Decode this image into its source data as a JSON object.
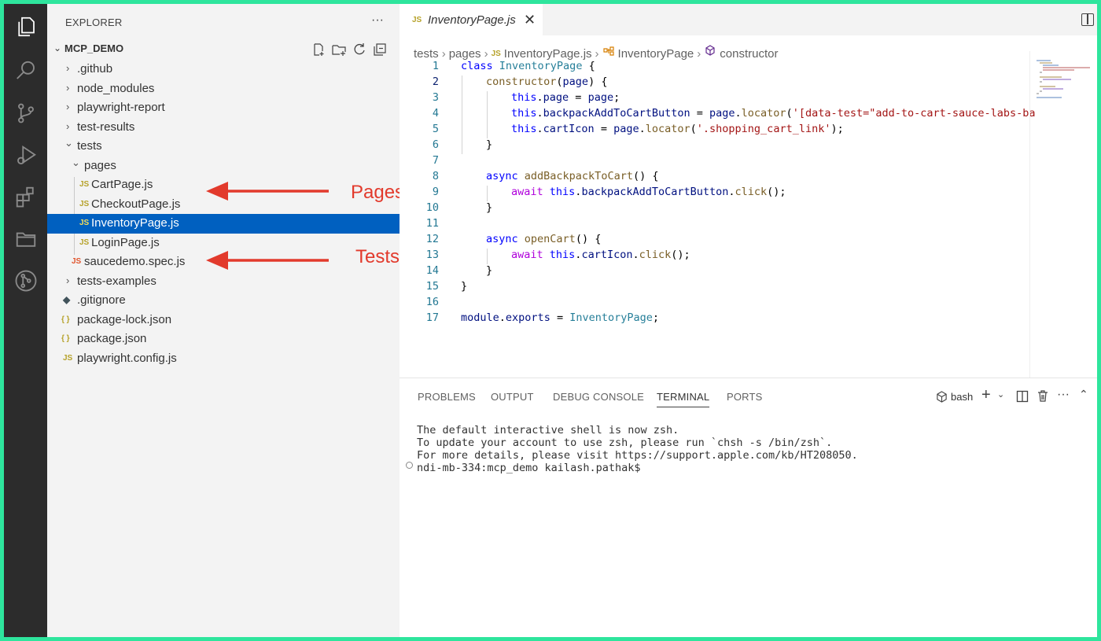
{
  "sidebar": {
    "title": "EXPLORER",
    "more": "···",
    "project": "MCP_DEMO",
    "tree": [
      {
        "label": ".github",
        "chevron": "›"
      },
      {
        "label": "node_modules",
        "chevron": "›"
      },
      {
        "label": "playwright-report",
        "chevron": "›"
      },
      {
        "label": "test-results",
        "chevron": "›"
      },
      {
        "label": "tests",
        "chevron": "⌄"
      },
      {
        "label": "pages",
        "chevron": "⌄"
      },
      {
        "label": "CartPage.js",
        "icon": "JS"
      },
      {
        "label": "CheckoutPage.js",
        "icon": "JS"
      },
      {
        "label": "InventoryPage.js",
        "icon": "JS"
      },
      {
        "label": "LoginPage.js",
        "icon": "JS"
      },
      {
        "label": "saucedemo.spec.js",
        "icon": "JS"
      },
      {
        "label": "tests-examples",
        "chevron": "›"
      },
      {
        "label": ".gitignore",
        "icon": "◆"
      },
      {
        "label": "package-lock.json",
        "icon": "{ }"
      },
      {
        "label": "package.json",
        "icon": "{ }"
      },
      {
        "label": "playwright.config.js",
        "icon": "JS"
      }
    ]
  },
  "annotations": {
    "pages": "Pages",
    "tests": "Tests"
  },
  "editor": {
    "tab_icon": "JS",
    "tab_title": "InventoryPage.js",
    "tab_close": "✕",
    "breadcrumb": {
      "p1": "tests",
      "p2": "pages",
      "icon": "JS",
      "p3": "InventoryPage.js",
      "p4": "InventoryPage",
      "p5": "constructor"
    },
    "line_numbers": [
      "1",
      "2",
      "3",
      "4",
      "5",
      "6",
      "7",
      "8",
      "9",
      "10",
      "11",
      "12",
      "13",
      "14",
      "15",
      "16",
      "17"
    ],
    "code": {
      "l1_kw": "class",
      "l1_cls": "InventoryPage",
      "l1_rest": " {",
      "l2_fn": "constructor",
      "l2_a": "(",
      "l2_p": "page",
      "l2_b": ") {",
      "l3_kw": "this",
      "l3_a": ".",
      "l3_p": "page",
      "l3_b": " = ",
      "l3_v": "page",
      "l3_c": ";",
      "l4_kw": "this",
      "l4_a": ".",
      "l4_p": "backpackAddToCartButton",
      "l4_b": " = ",
      "l4_v": "page",
      "l4_c": ".",
      "l4_fn": "locator",
      "l4_d": "(",
      "l4_s": "'[data-test=\"add-to-cart-sauce-labs-ba",
      "l5_kw": "this",
      "l5_a": ".",
      "l5_p": "cartIcon",
      "l5_b": " = ",
      "l5_v": "page",
      "l5_c": ".",
      "l5_fn": "locator",
      "l5_d": "(",
      "l5_s": "'.shopping_cart_link'",
      "l5_e": ");",
      "l6": "}",
      "l8_kw": "async",
      "l8_fn": "addBackpackToCart",
      "l8_rest": "() {",
      "l9_kw": "await",
      "l9_this": "this",
      "l9_a": ".",
      "l9_p": "backpackAddToCartButton",
      "l9_b": ".",
      "l9_fn": "click",
      "l9_c": "();",
      "l10": "}",
      "l12_kw": "async",
      "l12_fn": "openCart",
      "l12_rest": "() {",
      "l13_kw": "await",
      "l13_this": "this",
      "l13_a": ".",
      "l13_p": "cartIcon",
      "l13_b": ".",
      "l13_fn": "click",
      "l13_c": "();",
      "l14": "}",
      "l15": "}",
      "l17_a": "module",
      "l17_b": ".",
      "l17_c": "exports",
      "l17_d": " = ",
      "l17_e": "InventoryPage",
      "l17_f": ";"
    }
  },
  "panel": {
    "tabs": [
      "PROBLEMS",
      "OUTPUT",
      "DEBUG CONSOLE",
      "TERMINAL",
      "PORTS"
    ],
    "profile": "bash",
    "terminal_lines": [
      "The default interactive shell is now zsh.",
      "To update your account to use zsh, please run `chsh -s /bin/zsh`.",
      "For more details, please visit https://support.apple.com/kb/HT208050.",
      "ndi-mb-334:mcp_demo kailash.pathak$"
    ]
  },
  "colors": {
    "frame": "#2ee59d",
    "activity_bar": "#2c2c2c",
    "selection": "#0060c0",
    "annotation": "#e23a2c"
  }
}
